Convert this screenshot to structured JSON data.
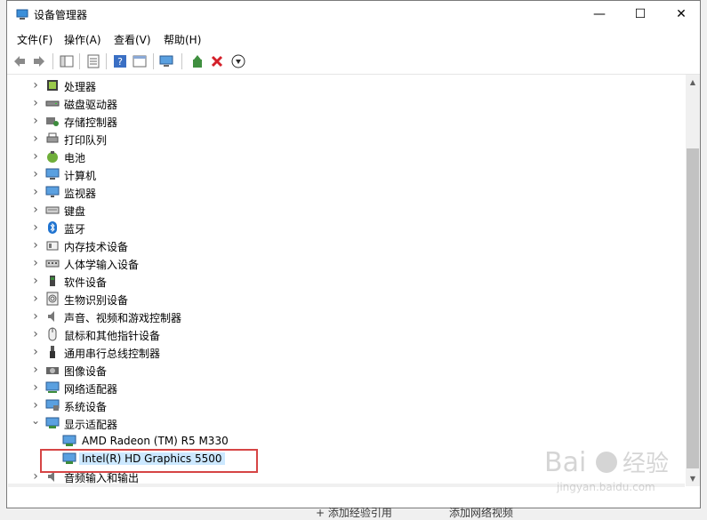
{
  "window": {
    "title": "设备管理器",
    "minimize_glyph": "—",
    "maximize_glyph": "☐",
    "close_glyph": "✕"
  },
  "menu": [
    "文件(F)",
    "操作(A)",
    "查看(V)",
    "帮助(H)"
  ],
  "toolbar": {
    "icons": [
      "back-icon",
      "forward-icon",
      "show-hide-tree-icon",
      "properties-icon",
      "help-icon",
      "view-icon",
      "scan-hardware-icon",
      "update-driver-icon",
      "uninstall-icon",
      "download-icon"
    ]
  },
  "tree": {
    "categories": [
      {
        "label": "处理器",
        "icon": "processor-icon",
        "expanded": false
      },
      {
        "label": "磁盘驱动器",
        "icon": "disk-drive-icon",
        "expanded": false
      },
      {
        "label": "存储控制器",
        "icon": "storage-controller-icon",
        "expanded": false
      },
      {
        "label": "打印队列",
        "icon": "printer-icon",
        "expanded": false
      },
      {
        "label": "电池",
        "icon": "battery-icon",
        "expanded": false
      },
      {
        "label": "计算机",
        "icon": "computer-icon",
        "expanded": false
      },
      {
        "label": "监视器",
        "icon": "monitor-icon",
        "expanded": false
      },
      {
        "label": "键盘",
        "icon": "keyboard-icon",
        "expanded": false
      },
      {
        "label": "蓝牙",
        "icon": "bluetooth-icon",
        "expanded": false
      },
      {
        "label": "内存技术设备",
        "icon": "memory-device-icon",
        "expanded": false
      },
      {
        "label": "人体学输入设备",
        "icon": "hid-icon",
        "expanded": false
      },
      {
        "label": "软件设备",
        "icon": "software-device-icon",
        "expanded": false
      },
      {
        "label": "生物识别设备",
        "icon": "fingerprint-icon",
        "expanded": false
      },
      {
        "label": "声音、视频和游戏控制器",
        "icon": "sound-icon",
        "expanded": false
      },
      {
        "label": "鼠标和其他指针设备",
        "icon": "mouse-icon",
        "expanded": false
      },
      {
        "label": "通用串行总线控制器",
        "icon": "usb-icon",
        "expanded": false
      },
      {
        "label": "图像设备",
        "icon": "camera-icon",
        "expanded": false
      },
      {
        "label": "网络适配器",
        "icon": "network-adapter-icon",
        "expanded": false
      },
      {
        "label": "系统设备",
        "icon": "system-device-icon",
        "expanded": false
      },
      {
        "label": "显示适配器",
        "icon": "display-adapter-icon",
        "expanded": true
      }
    ],
    "display_children": [
      {
        "label": "AMD Radeon (TM) R5 M330",
        "icon": "display-card-icon"
      },
      {
        "label": "Intel(R) HD Graphics 5500",
        "icon": "display-card-icon"
      }
    ],
    "last_partial": {
      "label": "音频输入和输出",
      "icon": "audio-io-icon"
    }
  },
  "watermark": {
    "brand": "Bai",
    "brand2": "经验",
    "url": "jingyan.baidu.com"
  },
  "bottom_links": [
    "+ 添加经验引用",
    "添加网络视频"
  ],
  "colors": {
    "highlight": "#d64545",
    "selection": "#cce8ff"
  }
}
